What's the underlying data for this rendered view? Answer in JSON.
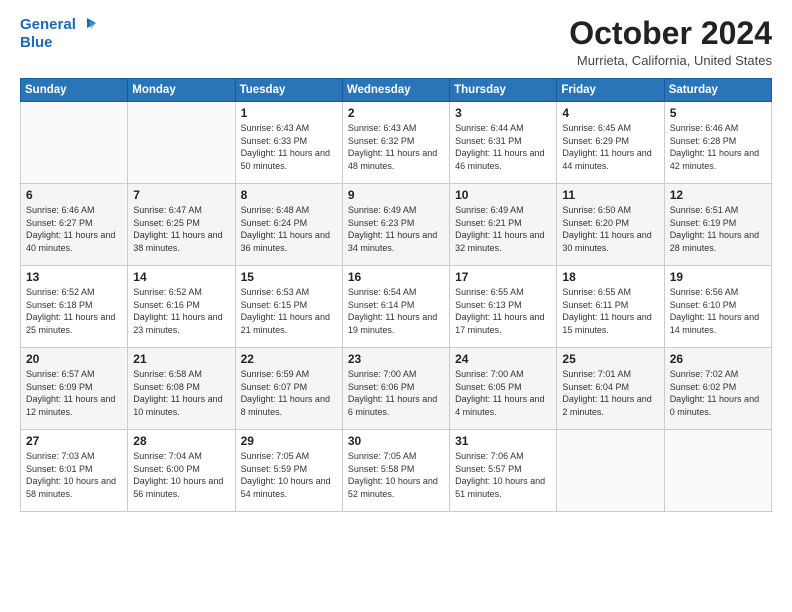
{
  "header": {
    "logo_line1": "General",
    "logo_line2": "Blue",
    "month": "October 2024",
    "location": "Murrieta, California, United States"
  },
  "weekdays": [
    "Sunday",
    "Monday",
    "Tuesday",
    "Wednesday",
    "Thursday",
    "Friday",
    "Saturday"
  ],
  "weeks": [
    [
      {
        "day": "",
        "sunrise": "",
        "sunset": "",
        "daylight": ""
      },
      {
        "day": "",
        "sunrise": "",
        "sunset": "",
        "daylight": ""
      },
      {
        "day": "1",
        "sunrise": "Sunrise: 6:43 AM",
        "sunset": "Sunset: 6:33 PM",
        "daylight": "Daylight: 11 hours and 50 minutes."
      },
      {
        "day": "2",
        "sunrise": "Sunrise: 6:43 AM",
        "sunset": "Sunset: 6:32 PM",
        "daylight": "Daylight: 11 hours and 48 minutes."
      },
      {
        "day": "3",
        "sunrise": "Sunrise: 6:44 AM",
        "sunset": "Sunset: 6:31 PM",
        "daylight": "Daylight: 11 hours and 46 minutes."
      },
      {
        "day": "4",
        "sunrise": "Sunrise: 6:45 AM",
        "sunset": "Sunset: 6:29 PM",
        "daylight": "Daylight: 11 hours and 44 minutes."
      },
      {
        "day": "5",
        "sunrise": "Sunrise: 6:46 AM",
        "sunset": "Sunset: 6:28 PM",
        "daylight": "Daylight: 11 hours and 42 minutes."
      }
    ],
    [
      {
        "day": "6",
        "sunrise": "Sunrise: 6:46 AM",
        "sunset": "Sunset: 6:27 PM",
        "daylight": "Daylight: 11 hours and 40 minutes."
      },
      {
        "day": "7",
        "sunrise": "Sunrise: 6:47 AM",
        "sunset": "Sunset: 6:25 PM",
        "daylight": "Daylight: 11 hours and 38 minutes."
      },
      {
        "day": "8",
        "sunrise": "Sunrise: 6:48 AM",
        "sunset": "Sunset: 6:24 PM",
        "daylight": "Daylight: 11 hours and 36 minutes."
      },
      {
        "day": "9",
        "sunrise": "Sunrise: 6:49 AM",
        "sunset": "Sunset: 6:23 PM",
        "daylight": "Daylight: 11 hours and 34 minutes."
      },
      {
        "day": "10",
        "sunrise": "Sunrise: 6:49 AM",
        "sunset": "Sunset: 6:21 PM",
        "daylight": "Daylight: 11 hours and 32 minutes."
      },
      {
        "day": "11",
        "sunrise": "Sunrise: 6:50 AM",
        "sunset": "Sunset: 6:20 PM",
        "daylight": "Daylight: 11 hours and 30 minutes."
      },
      {
        "day": "12",
        "sunrise": "Sunrise: 6:51 AM",
        "sunset": "Sunset: 6:19 PM",
        "daylight": "Daylight: 11 hours and 28 minutes."
      }
    ],
    [
      {
        "day": "13",
        "sunrise": "Sunrise: 6:52 AM",
        "sunset": "Sunset: 6:18 PM",
        "daylight": "Daylight: 11 hours and 25 minutes."
      },
      {
        "day": "14",
        "sunrise": "Sunrise: 6:52 AM",
        "sunset": "Sunset: 6:16 PM",
        "daylight": "Daylight: 11 hours and 23 minutes."
      },
      {
        "day": "15",
        "sunrise": "Sunrise: 6:53 AM",
        "sunset": "Sunset: 6:15 PM",
        "daylight": "Daylight: 11 hours and 21 minutes."
      },
      {
        "day": "16",
        "sunrise": "Sunrise: 6:54 AM",
        "sunset": "Sunset: 6:14 PM",
        "daylight": "Daylight: 11 hours and 19 minutes."
      },
      {
        "day": "17",
        "sunrise": "Sunrise: 6:55 AM",
        "sunset": "Sunset: 6:13 PM",
        "daylight": "Daylight: 11 hours and 17 minutes."
      },
      {
        "day": "18",
        "sunrise": "Sunrise: 6:55 AM",
        "sunset": "Sunset: 6:11 PM",
        "daylight": "Daylight: 11 hours and 15 minutes."
      },
      {
        "day": "19",
        "sunrise": "Sunrise: 6:56 AM",
        "sunset": "Sunset: 6:10 PM",
        "daylight": "Daylight: 11 hours and 14 minutes."
      }
    ],
    [
      {
        "day": "20",
        "sunrise": "Sunrise: 6:57 AM",
        "sunset": "Sunset: 6:09 PM",
        "daylight": "Daylight: 11 hours and 12 minutes."
      },
      {
        "day": "21",
        "sunrise": "Sunrise: 6:58 AM",
        "sunset": "Sunset: 6:08 PM",
        "daylight": "Daylight: 11 hours and 10 minutes."
      },
      {
        "day": "22",
        "sunrise": "Sunrise: 6:59 AM",
        "sunset": "Sunset: 6:07 PM",
        "daylight": "Daylight: 11 hours and 8 minutes."
      },
      {
        "day": "23",
        "sunrise": "Sunrise: 7:00 AM",
        "sunset": "Sunset: 6:06 PM",
        "daylight": "Daylight: 11 hours and 6 minutes."
      },
      {
        "day": "24",
        "sunrise": "Sunrise: 7:00 AM",
        "sunset": "Sunset: 6:05 PM",
        "daylight": "Daylight: 11 hours and 4 minutes."
      },
      {
        "day": "25",
        "sunrise": "Sunrise: 7:01 AM",
        "sunset": "Sunset: 6:04 PM",
        "daylight": "Daylight: 11 hours and 2 minutes."
      },
      {
        "day": "26",
        "sunrise": "Sunrise: 7:02 AM",
        "sunset": "Sunset: 6:02 PM",
        "daylight": "Daylight: 11 hours and 0 minutes."
      }
    ],
    [
      {
        "day": "27",
        "sunrise": "Sunrise: 7:03 AM",
        "sunset": "Sunset: 6:01 PM",
        "daylight": "Daylight: 10 hours and 58 minutes."
      },
      {
        "day": "28",
        "sunrise": "Sunrise: 7:04 AM",
        "sunset": "Sunset: 6:00 PM",
        "daylight": "Daylight: 10 hours and 56 minutes."
      },
      {
        "day": "29",
        "sunrise": "Sunrise: 7:05 AM",
        "sunset": "Sunset: 5:59 PM",
        "daylight": "Daylight: 10 hours and 54 minutes."
      },
      {
        "day": "30",
        "sunrise": "Sunrise: 7:05 AM",
        "sunset": "Sunset: 5:58 PM",
        "daylight": "Daylight: 10 hours and 52 minutes."
      },
      {
        "day": "31",
        "sunrise": "Sunrise: 7:06 AM",
        "sunset": "Sunset: 5:57 PM",
        "daylight": "Daylight: 10 hours and 51 minutes."
      },
      {
        "day": "",
        "sunrise": "",
        "sunset": "",
        "daylight": ""
      },
      {
        "day": "",
        "sunrise": "",
        "sunset": "",
        "daylight": ""
      }
    ]
  ]
}
